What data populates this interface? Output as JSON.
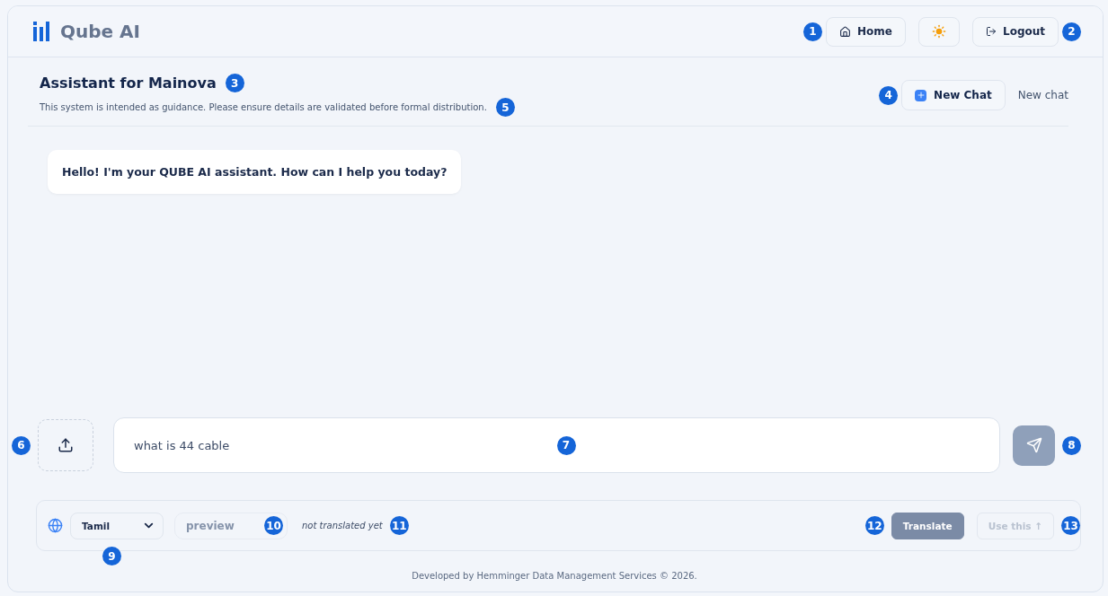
{
  "header": {
    "brand": "Qube AI",
    "home": {
      "label": "Home",
      "callout": "1"
    },
    "logout": {
      "label": "Logout",
      "callout": "2"
    }
  },
  "assistant": {
    "title": "Assistant for Mainova",
    "title_callout": "3",
    "subtitle": "This system is intended as guidance. Please ensure details are validated before formal distribution.",
    "subtitle_callout": "5",
    "new_chat_button": {
      "label": "New Chat",
      "callout": "4"
    },
    "new_chat_link": "New chat"
  },
  "messages": [
    {
      "text": "Hello! I'm your QUBE AI assistant. How can I help you today?"
    }
  ],
  "composer": {
    "upload_callout": "6",
    "value": "what is 44 cable",
    "input_callout": "7",
    "send_callout": "8"
  },
  "translate_bar": {
    "language": "Tamil",
    "language_callout": "9",
    "preview_placeholder": "preview",
    "preview_callout": "10",
    "status": "not translated yet",
    "status_callout": "11",
    "translate": {
      "label": "Translate",
      "callout": "12",
      "disabled": false
    },
    "use_this": {
      "label": "Use this ↑",
      "callout": "13",
      "disabled": true
    }
  },
  "footer": "Developed by Hemminger Data Management Services © 2026."
}
